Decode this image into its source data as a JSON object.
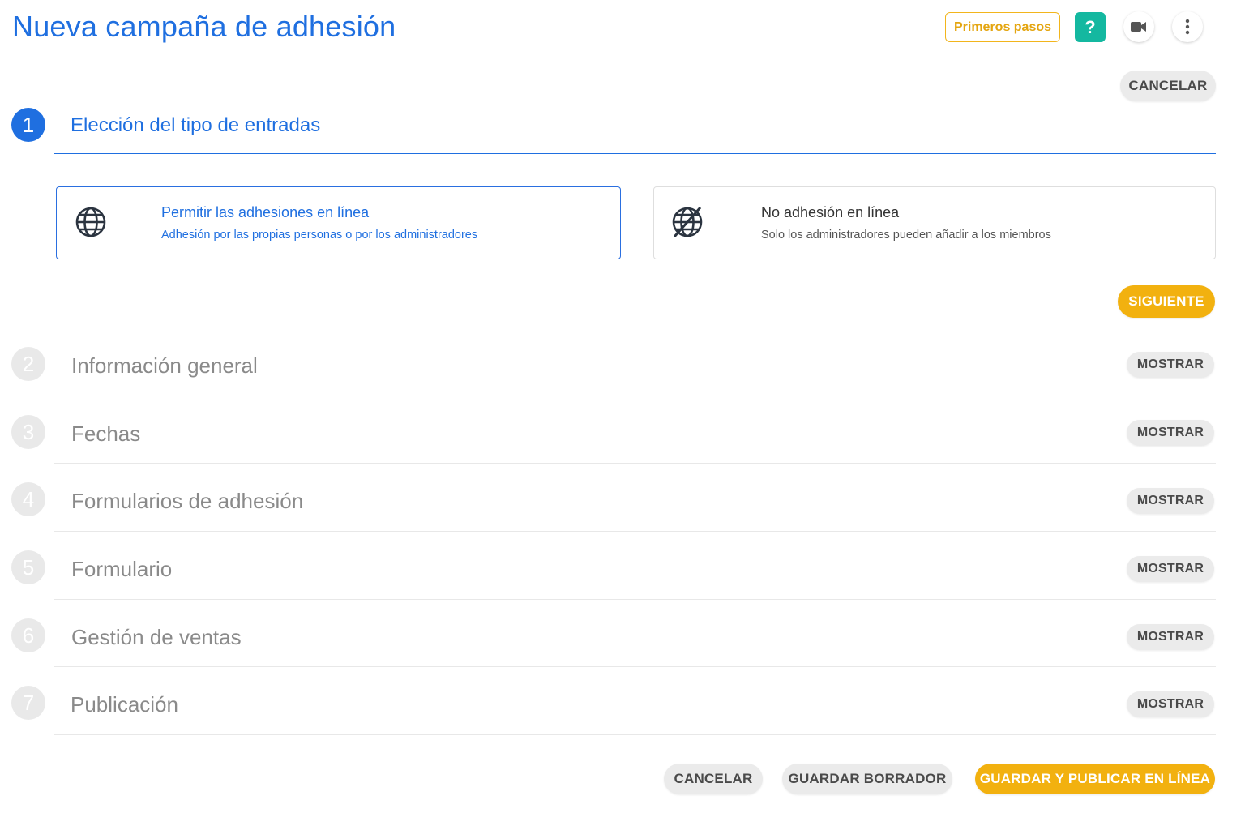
{
  "header": {
    "title": "Nueva campaña de adhesión",
    "primeros_pasos": "Primeros pasos",
    "help_label": "?",
    "video_icon": "video-camera-icon",
    "more_icon": "more-vertical-icon"
  },
  "top_cancel": "CANCELAR",
  "step1": {
    "number": "1",
    "title": "Elección del tipo de entradas",
    "options": [
      {
        "icon": "globe-icon",
        "title": "Permitir las adhesiones en línea",
        "subtitle": "Adhesión por las propias personas o por los administradores",
        "selected": true
      },
      {
        "icon": "globe-off-icon",
        "title": "No adhesión en línea",
        "subtitle": "Solo los administradores pueden añadir a los miembros",
        "selected": false
      }
    ],
    "next_label": "SIGUIENTE"
  },
  "steps": [
    {
      "number": "2",
      "title": "Información general",
      "action": "MOSTRAR"
    },
    {
      "number": "3",
      "title": "Fechas",
      "action": "MOSTRAR"
    },
    {
      "number": "4",
      "title": "Formularios de adhesión",
      "action": "MOSTRAR"
    },
    {
      "number": "5",
      "title": "Formulario",
      "action": "MOSTRAR"
    },
    {
      "number": "6",
      "title": "Gestión de ventas",
      "action": "MOSTRAR"
    },
    {
      "number": "7",
      "title": "Publicación",
      "action": "MOSTRAR"
    }
  ],
  "footer": {
    "cancel": "CANCELAR",
    "save_draft": "GUARDAR BORRADOR",
    "save_publish": "GUARDAR Y PUBLICAR EN LÍNEA"
  },
  "colors": {
    "primary": "#1f6fe0",
    "accent_yellow": "#f2b10f",
    "help_teal": "#14b8a0",
    "inactive": "#e9e9e9"
  }
}
